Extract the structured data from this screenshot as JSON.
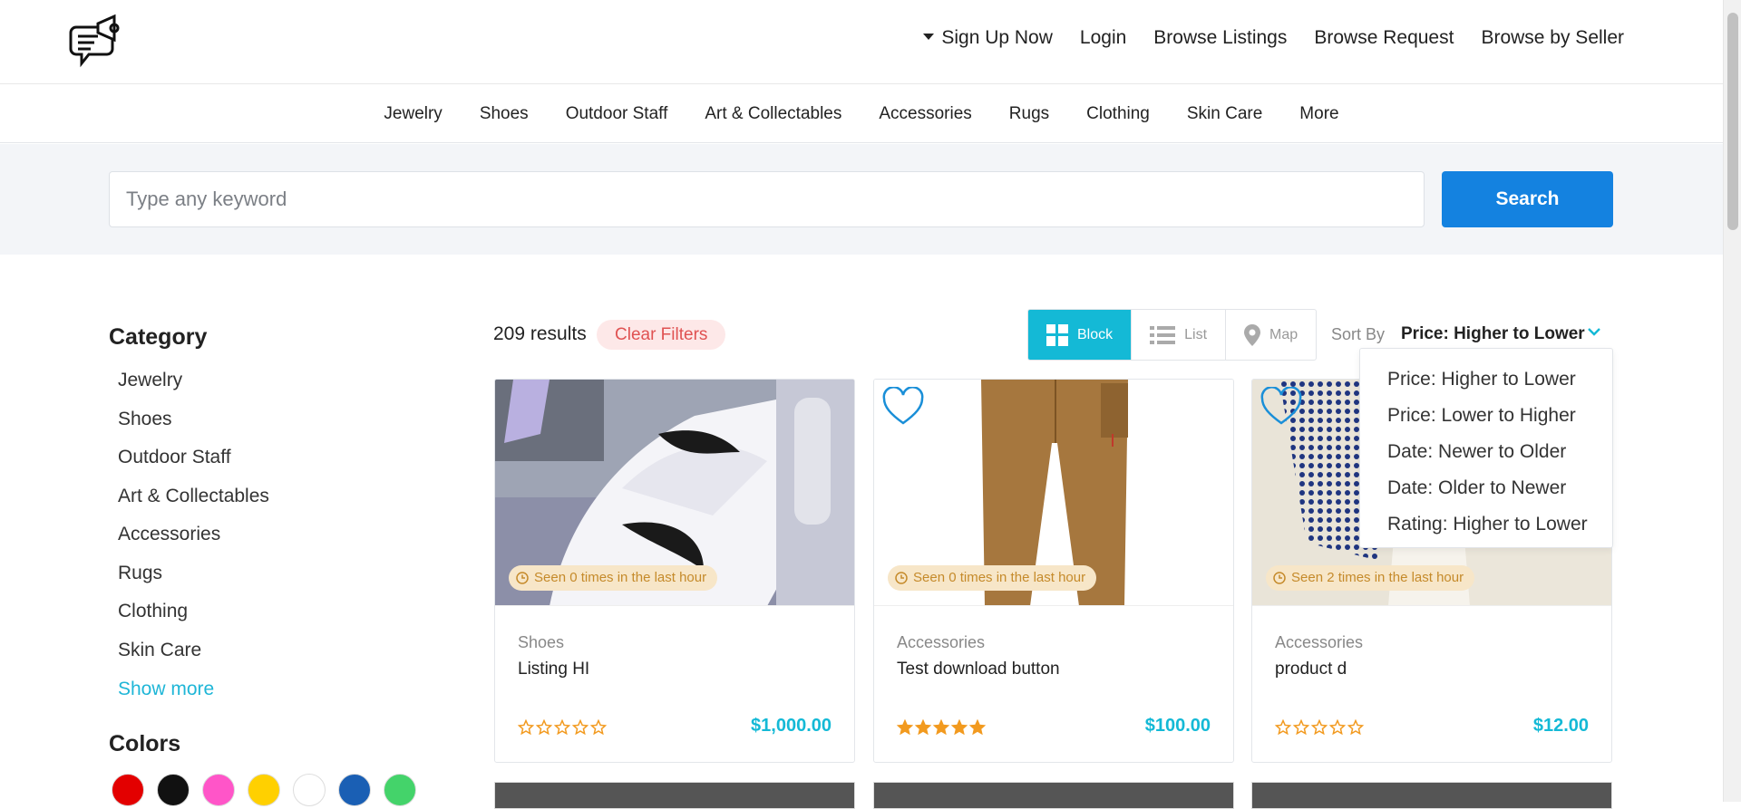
{
  "header": {
    "logo_icon": "megaphone-chat-logo",
    "nav": [
      {
        "label": "Sign Up Now",
        "dropdown": true
      },
      {
        "label": "Login"
      },
      {
        "label": "Browse Listings"
      },
      {
        "label": "Browse Request"
      },
      {
        "label": "Browse by Seller"
      }
    ]
  },
  "category_bar": [
    "Jewelry",
    "Shoes",
    "Outdoor Staff",
    "Art & Collectables",
    "Accessories",
    "Rugs",
    "Clothing",
    "Skin Care",
    "More"
  ],
  "search": {
    "placeholder": "Type any keyword",
    "value": "",
    "button_label": "Search",
    "button_color": "#1482e0"
  },
  "sidebar": {
    "category_title": "Category",
    "categories": [
      "Jewelry",
      "Shoes",
      "Outdoor Staff",
      "Art & Collectables",
      "Accessories",
      "Rugs",
      "Clothing",
      "Skin Care"
    ],
    "show_more_label": "Show more",
    "colors_title": "Colors",
    "colors": [
      "#e30000",
      "#111111",
      "#ff55c8",
      "#ffd000",
      "#ffffff",
      "#1a5fb4",
      "#44d36a"
    ]
  },
  "toolbar": {
    "results_text": "209 results",
    "clear_filters_label": "Clear Filters",
    "views": [
      {
        "label": "Block",
        "icon": "grid-icon",
        "active": true
      },
      {
        "label": "List",
        "icon": "list-icon",
        "active": false
      },
      {
        "label": "Map",
        "icon": "map-pin-icon",
        "active": false
      }
    ],
    "sort_label": "Sort By",
    "sort_value": "Price: Higher to Lower",
    "sort_options": [
      "Price: Higher to Lower",
      "Price: Lower to Higher",
      "Date: Newer to Older",
      "Date: Older to Newer",
      "Rating: Higher to Lower"
    ],
    "accent_color": "#14b9d6"
  },
  "listings": [
    {
      "category": "Shoes",
      "title": "Listing HI",
      "seen": "Seen 0 times in the last hour",
      "price": "$1,000.00",
      "rating": 0,
      "image": "white-sneaker-photo",
      "favorite_icon": false
    },
    {
      "category": "Accessories",
      "title": "Test download button",
      "seen": "Seen 0 times in the last hour",
      "price": "$100.00",
      "rating": 5,
      "image": "brown-cargo-pants-photo",
      "favorite_icon": true
    },
    {
      "category": "Accessories",
      "title": "product d",
      "seen": "Seen 2 times in the last hour",
      "price": "$12.00",
      "rating": 0,
      "image": "dotted-work-gloves-photo",
      "favorite_icon": true
    }
  ]
}
